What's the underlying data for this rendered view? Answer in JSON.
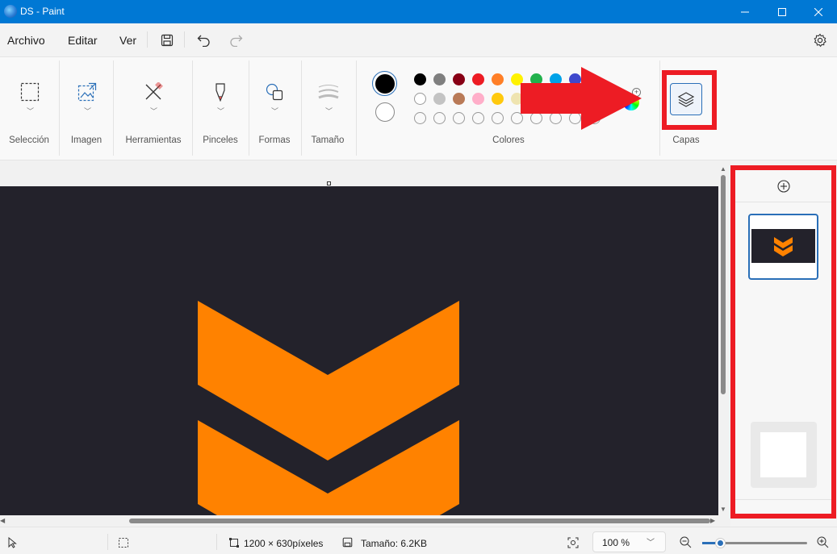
{
  "window": {
    "title": "DS - Paint",
    "controls": {
      "minimize": "—",
      "maximize": "☐",
      "close": "✕"
    }
  },
  "menu": {
    "items": [
      "Archivo",
      "Editar",
      "Ver"
    ]
  },
  "ribbon": {
    "groups": {
      "seleccion": "Selección",
      "imagen": "Imagen",
      "herramientas": "Herramientas",
      "pinceles": "Pinceles",
      "formas": "Formas",
      "tamano": "Tamaño",
      "colores": "Colores",
      "capas": "Capas"
    },
    "colors": {
      "row1": [
        "#000000",
        "#7f7f7f",
        "#880015",
        "#ed1c24",
        "#ff7f27",
        "#fff200",
        "#22b14c",
        "#00a2e8",
        "#3f48cc"
      ],
      "row2": [
        "#ffffff",
        "#c3c3c3",
        "#b97a57",
        "#ffaec9",
        "#ffc90e",
        "#efe4b0"
      ],
      "primary": "#000000",
      "secondary": "#ffffff"
    }
  },
  "status": {
    "dimensions": "1200 × 630píxeles",
    "size": "Tamaño: 6.2KB",
    "zoom": "100 %"
  },
  "accents": {
    "titlebar": "#0078d4",
    "highlight_red": "#ed1c24",
    "logo_orange": "#ff8200",
    "canvas_bg": "#23222b"
  }
}
